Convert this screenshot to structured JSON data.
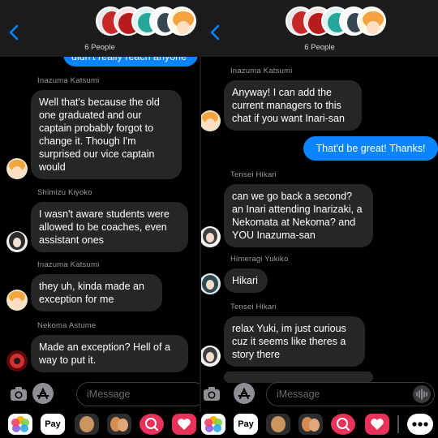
{
  "left": {
    "header": {
      "people_label": "6 People"
    },
    "partial_outgoing": "didn't really reach anyone",
    "messages": [
      {
        "sender": "Inazuma Katsumi",
        "text": "Well that's because the old one graduated and our captain probably forgot to change it. Though I'm surprised our vice captain would"
      },
      {
        "sender": "Shimizu Kiyoko",
        "text": "I wasn't aware students were allowed to be coaches, even assistant ones"
      },
      {
        "sender": "Inazuma Katsumi",
        "text": "they uh, kinda made an exception for me"
      },
      {
        "sender": "Nekoma Astume",
        "text": "Made an exception? Hell of a way to put it."
      }
    ],
    "input": {
      "placeholder": "iMessage"
    }
  },
  "right": {
    "header": {
      "people_label": "6 People"
    },
    "messages": [
      {
        "sender": "Inazuma Katsumi",
        "text": "Anyway! I can add the current managers to this chat if you want Inari-san"
      },
      {
        "sender": "",
        "text": "That'd be great! Thanks!"
      },
      {
        "sender": "Tensei Hikari",
        "text": "can we go back a second? an Inari attending Inarizaki, a Nekomata at Nekoma? and YOU Inazuma-san"
      },
      {
        "sender": "Himeragi Yukiko",
        "text": "Hikari"
      },
      {
        "sender": "Tensei Hikari",
        "text": "relax Yuki, im just curious cuz it seems like theres a story there"
      }
    ],
    "input": {
      "placeholder": "iMessage"
    }
  },
  "app_strip": {
    "apple_pay_label": "Pay",
    "apps": [
      "photos-app",
      "apple-pay-app",
      "memoji-app",
      "memoji-stickers-app",
      "image-search-app",
      "digital-touch-app",
      "photos-app",
      "apple-pay-app",
      "memoji-app",
      "memoji-stickers-app",
      "image-search-app",
      "digital-touch-app",
      "more-apps"
    ]
  },
  "colors": {
    "background": "#000000",
    "incoming_bubble": "#262628",
    "outgoing_bubble": "#0a84ff",
    "header": "#1c1c1e",
    "sender_text": "#9a9a9f"
  }
}
